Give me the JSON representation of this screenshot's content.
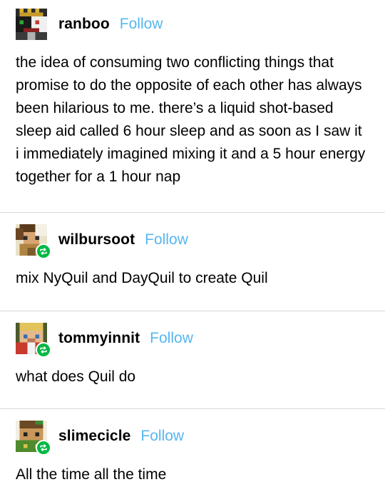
{
  "posts": [
    {
      "username": "ranboo",
      "follow_label": "Follow",
      "reblogged": false,
      "body": "the idea of consuming two conflicting things that promise to do the opposite of each other has always been hilarious to me. there’s a liquid shot-based sleep aid called 6 hour sleep and as soon as I saw it i immediately imagined mixing it and a 5 hour energy together for a 1 hour nap"
    },
    {
      "username": "wilbursoot",
      "follow_label": "Follow",
      "reblogged": true,
      "body": "mix NyQuil and DayQuil to create Quil"
    },
    {
      "username": "tommyinnit",
      "follow_label": "Follow",
      "reblogged": true,
      "body": "what does Quil do"
    },
    {
      "username": "slimecicle",
      "follow_label": "Follow",
      "reblogged": true,
      "body": "All the time all the time"
    }
  ],
  "colors": {
    "follow": "#56b7f0",
    "divider": "#d8d8d8",
    "reblog_badge": "#00b843"
  },
  "icons": {
    "reblog": "reblog-icon",
    "avatar": "pixel-avatar"
  }
}
